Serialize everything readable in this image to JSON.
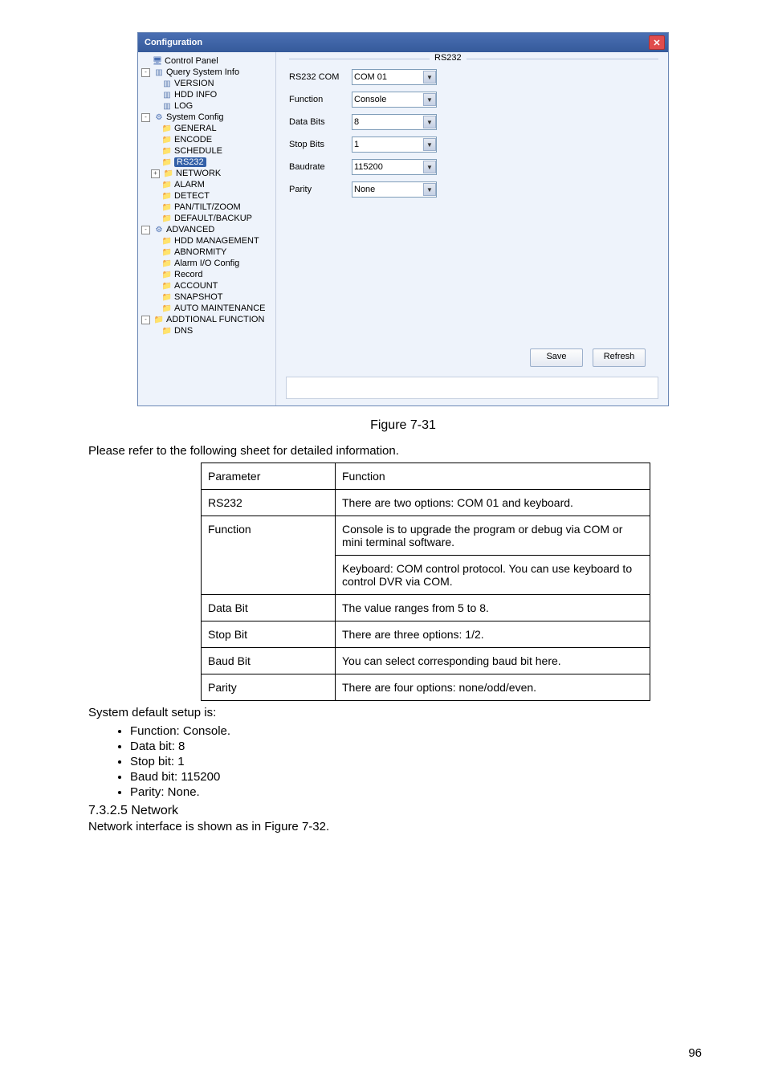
{
  "window": {
    "title": "Configuration",
    "fieldset_label": "RS232",
    "tree": [
      {
        "indent": 0,
        "icon": "monitor",
        "label": "Control Panel",
        "expander": ""
      },
      {
        "indent": 0,
        "icon": "file",
        "label": "Query System Info",
        "expander": "-"
      },
      {
        "indent": 1,
        "icon": "file",
        "label": "VERSION",
        "expander": ""
      },
      {
        "indent": 1,
        "icon": "file",
        "label": "HDD INFO",
        "expander": ""
      },
      {
        "indent": 1,
        "icon": "file",
        "label": "LOG",
        "expander": ""
      },
      {
        "indent": 0,
        "icon": "gear",
        "label": "System Config",
        "expander": "-"
      },
      {
        "indent": 1,
        "icon": "folder",
        "label": "GENERAL",
        "expander": ""
      },
      {
        "indent": 1,
        "icon": "folder",
        "label": "ENCODE",
        "expander": ""
      },
      {
        "indent": 1,
        "icon": "folder",
        "label": "SCHEDULE",
        "expander": ""
      },
      {
        "indent": 1,
        "icon": "folder",
        "label": "RS232",
        "expander": "",
        "selected": true
      },
      {
        "indent": 1,
        "icon": "folder",
        "label": "NETWORK",
        "expander": "+"
      },
      {
        "indent": 1,
        "icon": "folder",
        "label": "ALARM",
        "expander": ""
      },
      {
        "indent": 1,
        "icon": "folder",
        "label": "DETECT",
        "expander": ""
      },
      {
        "indent": 1,
        "icon": "folder",
        "label": "PAN/TILT/ZOOM",
        "expander": ""
      },
      {
        "indent": 1,
        "icon": "folder",
        "label": "DEFAULT/BACKUP",
        "expander": ""
      },
      {
        "indent": 0,
        "icon": "gear",
        "label": "ADVANCED",
        "expander": "-"
      },
      {
        "indent": 1,
        "icon": "folder",
        "label": "HDD MANAGEMENT",
        "expander": ""
      },
      {
        "indent": 1,
        "icon": "folder",
        "label": "ABNORMITY",
        "expander": ""
      },
      {
        "indent": 1,
        "icon": "folder",
        "label": "Alarm I/O Config",
        "expander": ""
      },
      {
        "indent": 1,
        "icon": "folder",
        "label": "Record",
        "expander": ""
      },
      {
        "indent": 1,
        "icon": "folder",
        "label": "ACCOUNT",
        "expander": ""
      },
      {
        "indent": 1,
        "icon": "folder",
        "label": "SNAPSHOT",
        "expander": ""
      },
      {
        "indent": 1,
        "icon": "folder",
        "label": "AUTO MAINTENANCE",
        "expander": ""
      },
      {
        "indent": 0,
        "icon": "folder",
        "label": "ADDTIONAL FUNCTION",
        "expander": "-"
      },
      {
        "indent": 1,
        "icon": "folder",
        "label": "DNS",
        "expander": ""
      }
    ],
    "fields": [
      {
        "label": "RS232 COM",
        "value": "COM 01"
      },
      {
        "label": "Function",
        "value": "Console"
      },
      {
        "label": "Data Bits",
        "value": "8"
      },
      {
        "label": "Stop Bits",
        "value": "1"
      },
      {
        "label": "Baudrate",
        "value": "115200"
      },
      {
        "label": "Parity",
        "value": "None"
      }
    ],
    "buttons": {
      "save": "Save",
      "refresh": "Refresh"
    }
  },
  "figure_caption": "Figure 7-31",
  "intro_text": "Please refer to the following sheet for detailed information.",
  "table": {
    "headers": [
      "Parameter",
      "Function"
    ],
    "rows": [
      {
        "param": "RS232",
        "func": "There are two options: COM 01 and keyboard."
      },
      {
        "param": "Function",
        "func": "Console is to upgrade the program or debug via COM or mini terminal software.",
        "func2": "Keyboard: COM control protocol. You can use keyboard to control DVR via COM."
      },
      {
        "param": "Data Bit",
        "func": "The value ranges from 5 to 8."
      },
      {
        "param": "Stop Bit",
        "func": "There are three options: 1/2."
      },
      {
        "param": "Baud Bit",
        "func": "You can select corresponding baud bit here."
      },
      {
        "param": "Parity",
        "func": "There are four options: none/odd/even."
      }
    ]
  },
  "defaults_intro": "System default setup is:",
  "defaults": [
    "Function: Console.",
    "Data bit: 8",
    "Stop bit: 1",
    "Baud bit: 115200",
    "Parity: None."
  ],
  "section_heading": "7.3.2.5  Network",
  "section_text": "Network interface is shown as in Figure 7-32.",
  "page_number": "96"
}
